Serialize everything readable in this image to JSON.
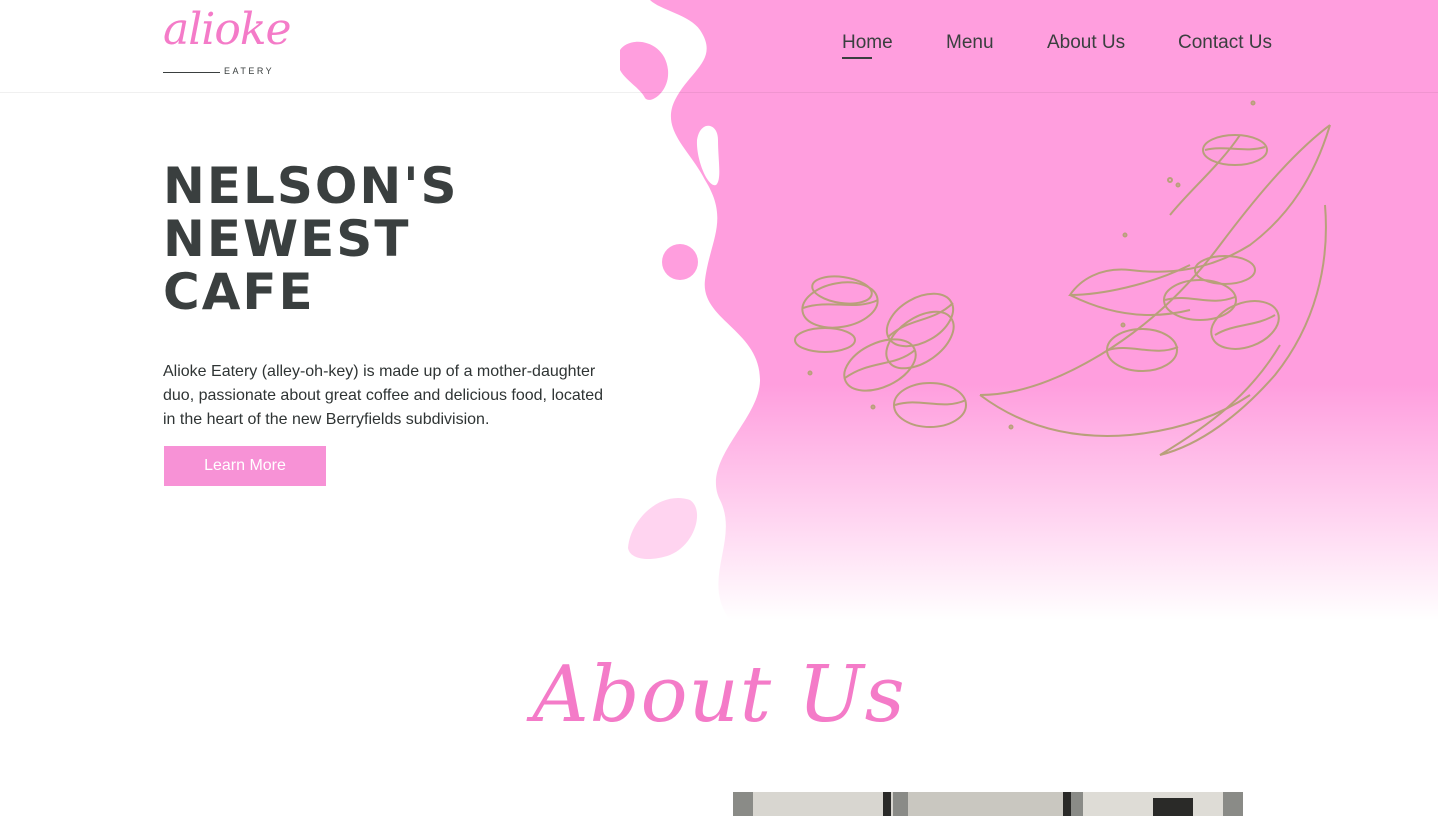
{
  "brand": {
    "name": "alioke",
    "tagline": "EATERY",
    "accent_color": "#f47bc8",
    "hero_pink": "#ff9ede"
  },
  "nav": {
    "items": [
      {
        "label": "Home",
        "active": true
      },
      {
        "label": "Menu",
        "active": false
      },
      {
        "label": "About Us",
        "active": false
      },
      {
        "label": "Contact Us",
        "active": false
      }
    ]
  },
  "hero": {
    "title_lines": [
      "NELSON'S",
      "NEWEST",
      "CAFE"
    ],
    "description": "Alioke Eatery (alley-oh-key) is made up of a mother-daughter duo, passionate about great coffee and delicious food,  located in the heart of the new Berryfields subdivision.",
    "cta_label": "Learn More",
    "illustration_icon": "coffee-beans-leaves-icon"
  },
  "about": {
    "heading": "About Us"
  }
}
